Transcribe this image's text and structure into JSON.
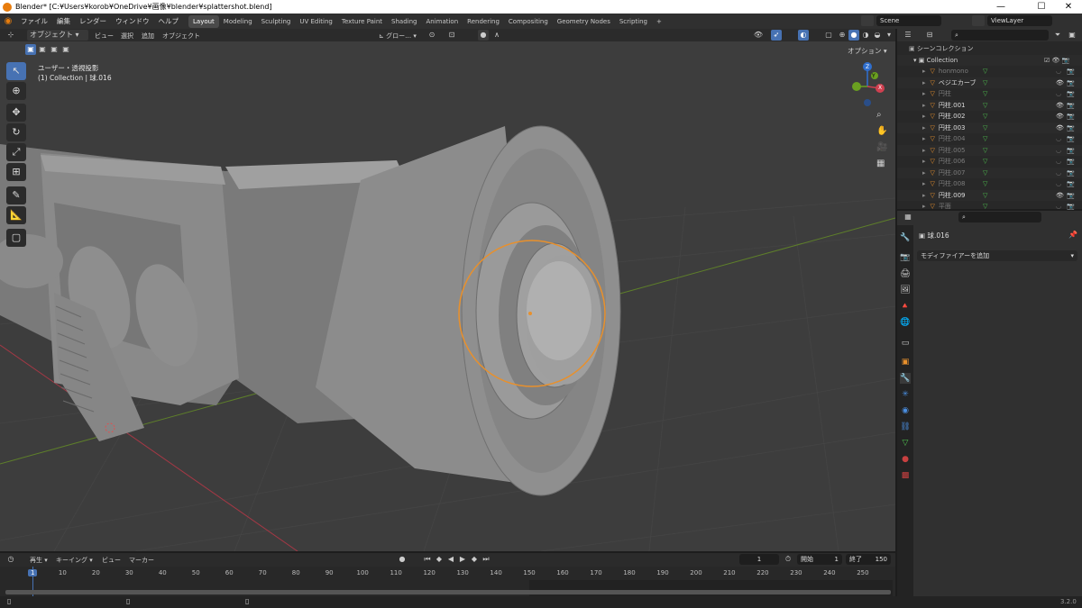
{
  "titlebar": {
    "title": "Blender* [C:¥Users¥korob¥OneDrive¥画像¥blender¥splattershot.blend]",
    "minimize": "—",
    "maximize": "☐",
    "close": "✕"
  },
  "menu": {
    "items": [
      "ファイル",
      "編集",
      "レンダー",
      "ウィンドウ",
      "ヘルプ"
    ]
  },
  "workspaces": {
    "tabs": [
      "Layout",
      "Modeling",
      "Sculpting",
      "UV Editing",
      "Texture Paint",
      "Shading",
      "Animation",
      "Rendering",
      "Compositing",
      "Geometry Nodes",
      "Scripting"
    ],
    "add": "+",
    "active": "Layout"
  },
  "scene": {
    "label": "Scene",
    "view_layer": "ViewLayer"
  },
  "viewport_header": {
    "mode": "オブジェクト",
    "menus": [
      "ビュー",
      "選択",
      "追加",
      "オブジェクト"
    ],
    "transform": "グロー…",
    "options": "オプション"
  },
  "viewport": {
    "view_name": "ユーザー・透視投影",
    "object_info": "(1) Collection | 球.016",
    "gizmo": {
      "z": "Z",
      "y": "Y",
      "x": "X"
    },
    "colors": {
      "background": "#3d3d3d",
      "selection": "#e8902c",
      "x_axis": "#b03a46",
      "y_axis": "#6a8c2c"
    }
  },
  "outliner": {
    "title": "シーンコレクション",
    "collection": "Collection",
    "items": [
      {
        "name": "honmono",
        "dim": true
      },
      {
        "name": "ベジエカーブ",
        "dim": false
      },
      {
        "name": "円柱",
        "dim": true
      },
      {
        "name": "円柱.001",
        "dim": false
      },
      {
        "name": "円柱.002",
        "dim": false
      },
      {
        "name": "円柱.003",
        "dim": false
      },
      {
        "name": "円柱.004",
        "dim": true
      },
      {
        "name": "円柱.005",
        "dim": true
      },
      {
        "name": "円柱.006",
        "dim": true
      },
      {
        "name": "円柱.007",
        "dim": true
      },
      {
        "name": "円柱.008",
        "dim": true
      },
      {
        "name": "円柱.009",
        "dim": false
      },
      {
        "name": "平面",
        "dim": true
      }
    ]
  },
  "properties": {
    "object_name": "球.016",
    "add_modifier": "モディファイアーを追加"
  },
  "timeline": {
    "menus": [
      "再生",
      "キーイング",
      "ビュー",
      "マーカー"
    ],
    "current_frame": "1",
    "start_label": "開始",
    "start": "1",
    "end_label": "終了",
    "end": "150",
    "ticks": [
      "1",
      "10",
      "20",
      "30",
      "40",
      "50",
      "60",
      "70",
      "80",
      "90",
      "100",
      "110",
      "120",
      "130",
      "140",
      "150",
      "160",
      "170",
      "180",
      "190",
      "200",
      "210",
      "220",
      "230",
      "240",
      "250"
    ]
  },
  "status": {
    "version": "3.2.0"
  }
}
